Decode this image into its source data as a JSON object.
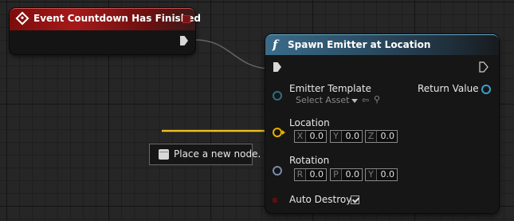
{
  "colors": {
    "canvas": "#262626",
    "event_header": "#a51a1a",
    "function_header": "#3a6c8a",
    "exec_wire": "#d8d8d8",
    "vector_wire": "#e8b000"
  },
  "event_node": {
    "title": "Event Countdown Has Finished",
    "icon": "event-diamond-icon"
  },
  "spawn_node": {
    "function_icon": "f",
    "title": "Spawn Emitter at Location",
    "inputs": {
      "emitter_template": {
        "label": "Emitter Template",
        "select_label": "Select Asset",
        "icons": [
          "use-selected-arrow-icon",
          "browse-search-icon"
        ]
      },
      "location": {
        "label": "Location",
        "x_axis": "X",
        "x": "0.0",
        "y_axis": "Y",
        "y": "0.0",
        "z_axis": "Z",
        "z": "0.0"
      },
      "rotation": {
        "label": "Rotation",
        "r_axis": "R",
        "r": "0.0",
        "p_axis": "P",
        "p": "0.0",
        "yaw_axis": "Y",
        "yaw": "0.0"
      },
      "auto_destroy": {
        "label": "Auto Destroy",
        "checked": true
      }
    },
    "outputs": {
      "return_value": {
        "label": "Return Value"
      }
    }
  },
  "tooltip": {
    "text": "Place a new node."
  }
}
